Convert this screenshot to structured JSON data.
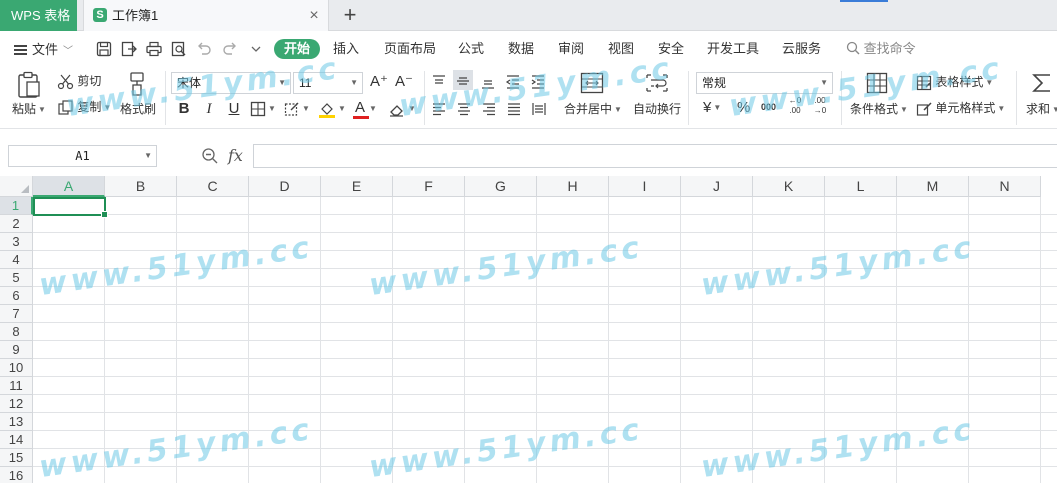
{
  "titlebar": {
    "app_tab": "WPS 表格",
    "doc_icon_letter": "S",
    "doc_title": "工作簿1",
    "close_glyph": "×",
    "new_tab_glyph": "+"
  },
  "menu": {
    "file_label": "文件",
    "tabs": [
      "开始",
      "插入",
      "页面布局",
      "公式",
      "数据",
      "审阅",
      "视图",
      "安全",
      "开发工具",
      "云服务"
    ],
    "active_tab": "开始",
    "search_placeholder": "查找命令"
  },
  "ribbon": {
    "paste_label": "粘贴",
    "cut_label": "剪切",
    "copy_label": "复制",
    "format_painter_label": "格式刷",
    "font_name": "宋体",
    "font_size": "11",
    "bold_glyph": "B",
    "italic_glyph": "I",
    "underline_glyph": "U",
    "font_color_glyph": "A",
    "increase_font_glyph": "A⁺",
    "decrease_font_glyph": "A⁻",
    "merge_center_label": "合并居中",
    "wrap_text_label": "自动换行",
    "number_format": "常规",
    "currency_glyph": "¥",
    "percent_glyph": "%",
    "thousands_glyph": "000",
    "inc_decimal_glyph": "←0 .00",
    "dec_decimal_glyph": ".00 →0",
    "conditional_format_label": "条件格式",
    "table_style_label": "表格样式",
    "cell_style_label": "单元格样式",
    "sum_label": "求和",
    "accent_color": "#3aa872",
    "font_color_underline": "#e02020",
    "fill_color_underline": "#ffd200"
  },
  "formula_bar": {
    "name_box": "A1",
    "fx_label": "fx",
    "formula_value": ""
  },
  "sheet": {
    "columns": [
      "A",
      "B",
      "C",
      "D",
      "E",
      "F",
      "G",
      "H",
      "I",
      "J",
      "K",
      "L",
      "M",
      "N"
    ],
    "rows": [
      "1",
      "2",
      "3",
      "4",
      "5",
      "6",
      "7",
      "8",
      "9",
      "10",
      "11",
      "12",
      "13",
      "14",
      "15",
      "16"
    ],
    "active_cell": "A1",
    "selection_color": "#1f8f55"
  },
  "watermark": "www.51ym.cc"
}
